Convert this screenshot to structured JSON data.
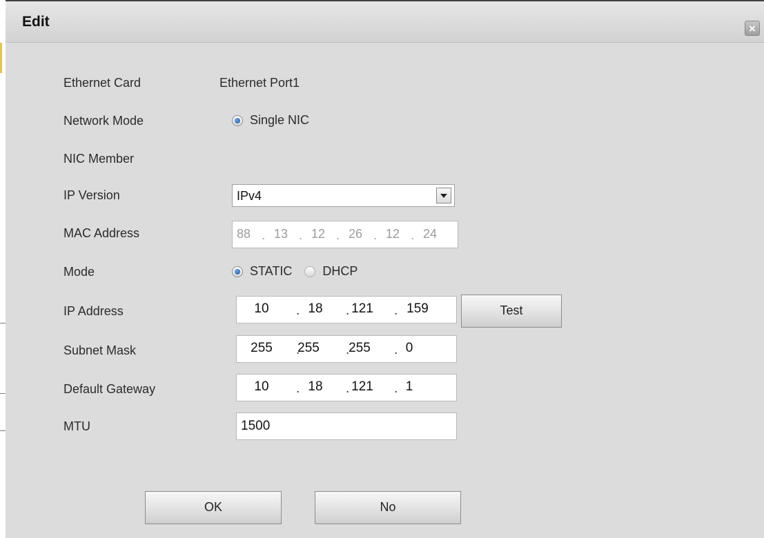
{
  "dialog": {
    "title": "Edit",
    "close_glyph": "×"
  },
  "form": {
    "ethernet_card": {
      "label": "Ethernet Card",
      "value": "Ethernet Port1"
    },
    "network_mode": {
      "label": "Network Mode",
      "option": "Single NIC",
      "selected": true
    },
    "nic_member": {
      "label": "NIC Member"
    },
    "ip_version": {
      "label": "IP Version",
      "value": "IPv4"
    },
    "mac_address": {
      "label": "MAC Address",
      "octets": [
        "88",
        "13",
        "12",
        "26",
        "12",
        "24"
      ],
      "enabled": false
    },
    "mode": {
      "label": "Mode",
      "options": [
        "STATIC",
        "DHCP"
      ],
      "selected": "STATIC"
    },
    "ip_address": {
      "label": "IP Address",
      "octets": [
        "10",
        "18",
        "121",
        "159"
      ]
    },
    "subnet_mask": {
      "label": "Subnet Mask",
      "octets": [
        "255",
        "255",
        "255",
        "0"
      ]
    },
    "default_gateway": {
      "label": "Default Gateway",
      "octets": [
        "10",
        "18",
        "121",
        "1"
      ]
    },
    "mtu": {
      "label": "MTU",
      "value": "1500"
    }
  },
  "buttons": {
    "test": "Test",
    "ok": "OK",
    "no": "No"
  },
  "icons": {
    "close": "close-icon",
    "dropdown": "chevron-down-icon",
    "radio": "radio-icon"
  },
  "colors": {
    "dialog_bg": "#dcdcdc",
    "radio_selected": "#1a55a8",
    "disabled_text": "#9c9c9c"
  }
}
